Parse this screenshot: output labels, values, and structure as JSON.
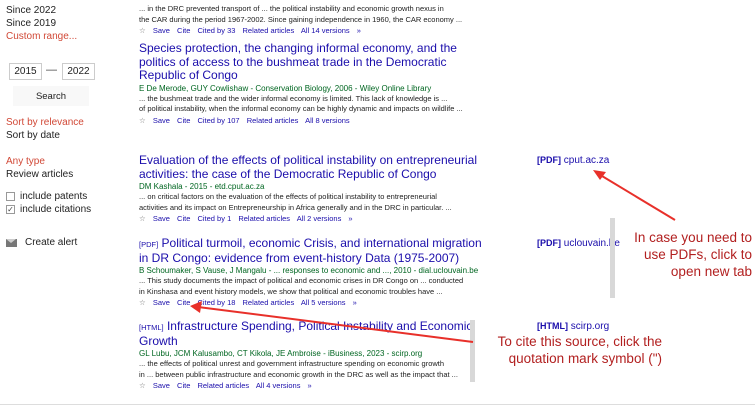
{
  "sidebar": {
    "since_2022": "Since 2022",
    "since_2019": "Since 2019",
    "custom_range": "Custom range...",
    "year_from": "2015",
    "year_to": "2022",
    "dash": "—",
    "search_label": "Search",
    "sort_relevance": "Sort by relevance",
    "sort_date": "Sort by date",
    "any_type": "Any type",
    "review_articles": "Review articles",
    "include_patents": "include patents",
    "include_citations": "include citations",
    "create_alert": "Create alert"
  },
  "results": [
    {
      "snippet": [
        "... in the DRC prevented transport of ... the political instability and economic growth nexus in",
        "the CAR during the period 1967-2002. Since gaining independence in 1960, the CAR economy ..."
      ],
      "actions": [
        "Save",
        "Cite",
        "Cited by 33",
        "Related articles",
        "All 14 versions",
        "»"
      ]
    },
    {
      "title": "Species protection, the changing informal economy, and the politics of access to the bushmeat trade in the Democratic Republic of Congo",
      "authors": "E De Merode, GUY Cowlishaw - Conservation Biology, 2006 - Wiley Online Library",
      "snippet": [
        "... the bushmeat trade and the wider informal economy is limited. This lack of knowledge is ...",
        "of political instability, when the informal economy can be highly dynamic and impacts on wildlife ..."
      ],
      "actions": [
        "Save",
        "Cite",
        "Cited by 107",
        "Related articles",
        "All 8 versions"
      ]
    },
    {
      "title": "Evaluation of the effects of political instability on entrepreneurial activities: the case of the Democratic Republic of Congo",
      "authors": "DM Kashala - 2015 - etd.cput.ac.za",
      "snippet": [
        "... on critical factors on the evaluation of the effects of political instability to entrepreneurial",
        "activities and its impact on Entrepreneurship in Africa generally and in the DRC in particular. ..."
      ],
      "actions": [
        "Save",
        "Cite",
        "Cited by 1",
        "Related articles",
        "All 2 versions",
        "»"
      ],
      "side_tag": "[PDF]",
      "side_link": "cput.ac.za"
    },
    {
      "tag": "[PDF]",
      "title": "Political turmoil, economic Crisis, and international migration in DR Congo: evidence from event-history Data (1975-2007)",
      "authors": "B Schoumaker, S Vause, J Mangalu - ... responses to economic and ..., 2010 - dial.uclouvain.be",
      "snippet": [
        "... This study documents the impact of political and economic crises in DR Congo on ... conducted",
        "in Kinshasa and event history models, we show that political and economic troubles have ..."
      ],
      "actions": [
        "Save",
        "Cite",
        "Cited by 18",
        "Related articles",
        "All 5 versions",
        "»"
      ],
      "side_tag": "[PDF]",
      "side_link": "uclouvain.be"
    },
    {
      "tag": "[HTML]",
      "title": "Infrastructure Spending, Political Instability and Economic Growth",
      "authors": "GL Lubu, JCM Kalusambo, CT Kikola, JE Ambroise - iBusiness, 2023 - scirp.org",
      "snippet": [
        "... the effects of political unrest and government infrastructure spending on economic growth",
        "in ... between public infrastructure and economic growth in the DRC as well as the impact that ..."
      ],
      "actions": [
        "Save",
        "Cite",
        "Related articles",
        "All 4 versions",
        "»"
      ],
      "side_tag": "[HTML]",
      "side_link": "scirp.org"
    }
  ],
  "annotations": {
    "pdf_note": [
      "In case you need to",
      "use PDFs, click to",
      "open new tab"
    ],
    "cite_note": [
      "To cite this source, click the",
      "quotation mark symbol (\")"
    ],
    "arrow_color": "#e8302a"
  },
  "icons": {
    "star": "☆",
    "cite": "99",
    "checkmark": "✓",
    "mail": "mail-icon"
  }
}
